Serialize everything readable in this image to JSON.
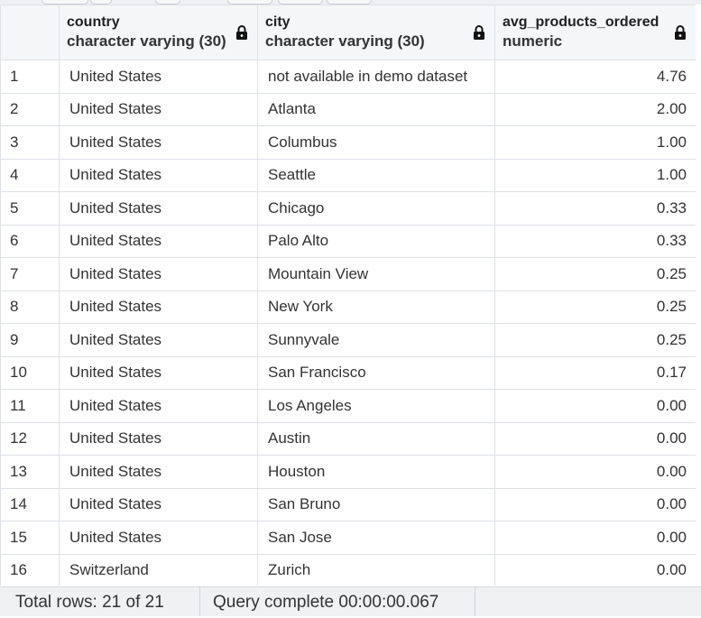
{
  "grid": {
    "columns": [
      {
        "name": "country",
        "type": "character varying (30)"
      },
      {
        "name": "city",
        "type": "character varying (30)"
      },
      {
        "name": "avg_products_ordered",
        "type": "numeric"
      }
    ],
    "rows": [
      {
        "n": "1",
        "country": "United States",
        "city": "not available in demo dataset",
        "avg": "4.76"
      },
      {
        "n": "2",
        "country": "United States",
        "city": "Atlanta",
        "avg": "2.00"
      },
      {
        "n": "3",
        "country": "United States",
        "city": "Columbus",
        "avg": "1.00"
      },
      {
        "n": "4",
        "country": "United States",
        "city": "Seattle",
        "avg": "1.00"
      },
      {
        "n": "5",
        "country": "United States",
        "city": "Chicago",
        "avg": "0.33"
      },
      {
        "n": "6",
        "country": "United States",
        "city": "Palo Alto",
        "avg": "0.33"
      },
      {
        "n": "7",
        "country": "United States",
        "city": "Mountain View",
        "avg": "0.25"
      },
      {
        "n": "8",
        "country": "United States",
        "city": "New York",
        "avg": "0.25"
      },
      {
        "n": "9",
        "country": "United States",
        "city": "Sunnyvale",
        "avg": "0.25"
      },
      {
        "n": "10",
        "country": "United States",
        "city": "San Francisco",
        "avg": "0.17"
      },
      {
        "n": "11",
        "country": "United States",
        "city": "Los Angeles",
        "avg": "0.00"
      },
      {
        "n": "12",
        "country": "United States",
        "city": "Austin",
        "avg": "0.00"
      },
      {
        "n": "13",
        "country": "United States",
        "city": "Houston",
        "avg": "0.00"
      },
      {
        "n": "14",
        "country": "United States",
        "city": "San Bruno",
        "avg": "0.00"
      },
      {
        "n": "15",
        "country": "United States",
        "city": "San Jose",
        "avg": "0.00"
      },
      {
        "n": "16",
        "country": "Switzerland",
        "city": "Zurich",
        "avg": "0.00"
      }
    ]
  },
  "status": {
    "total_rows": "Total rows: 21 of 21",
    "query_status": "Query complete 00:00:00.067"
  },
  "icons": {
    "column_lock": "lock-icon"
  }
}
